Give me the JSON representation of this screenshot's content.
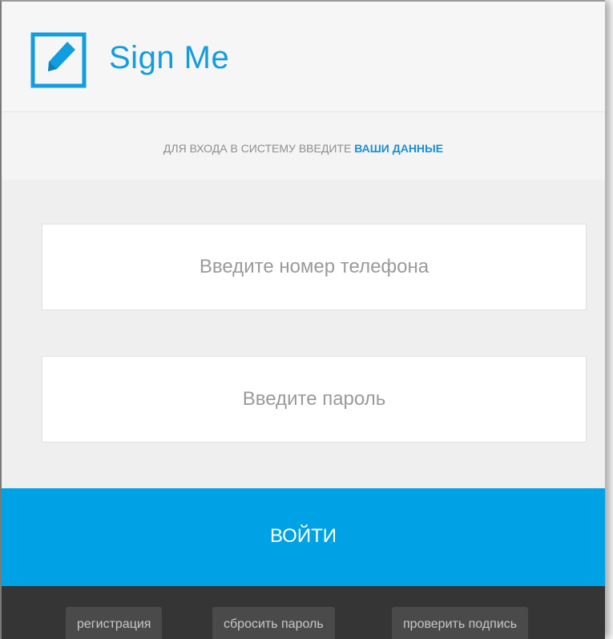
{
  "app": {
    "title": "Sign Me",
    "brand_color": "#129ddf",
    "logo_icon": "pen-square-icon"
  },
  "subtitle": {
    "prefix": "ДЛЯ ВХОДА В СИСТЕМУ ВВЕДИТЕ",
    "highlight": "ВАШИ ДАННЫЕ",
    "highlight_color": "#1b8fd2"
  },
  "form": {
    "phone": {
      "placeholder": "Введите номер телефона",
      "value": ""
    },
    "password": {
      "placeholder": "Введите пароль",
      "value": ""
    }
  },
  "login": {
    "label": "ВОЙТИ",
    "color": "#00a2e6"
  },
  "footer": {
    "register_label": "регистрация",
    "reset_label": "сбросить пароль",
    "verify_label": "проверить подпись"
  }
}
